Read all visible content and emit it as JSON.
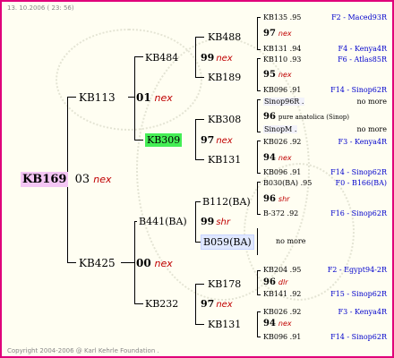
{
  "header": {
    "date": "13. 10.2006 ( 23: 56)"
  },
  "footer": {
    "copyright": "Copyright 2004-2006 @ Karl Kehrle Foundation ."
  },
  "root": {
    "id": "KB169",
    "year": "03",
    "mark": "nex"
  },
  "gen2": [
    {
      "id": "KB113",
      "year": "01",
      "mark": "nex"
    },
    {
      "id": "KB425",
      "year": "00",
      "mark": "nex"
    }
  ],
  "gen3": [
    {
      "id": "KB484",
      "year": "99",
      "mark": "nex"
    },
    {
      "id": "KB309",
      "year": "97",
      "mark": "nex"
    },
    {
      "id": "B441(BA)",
      "year": "99",
      "mark": "shr"
    },
    {
      "id": "KB232",
      "year": "97",
      "mark": "nex"
    }
  ],
  "gen4": [
    {
      "id": "KB488",
      "year": "97",
      "mark": "nex"
    },
    {
      "id": "KB189",
      "year": "95",
      "mark": "nex"
    },
    {
      "id": "KB308",
      "year": "96",
      "mark": "pure anatolica (Sinop)"
    },
    {
      "id": "KB131",
      "year": "94",
      "mark": "nex"
    },
    {
      "id": "B112(BA)",
      "year": "96",
      "mark": "shr"
    },
    {
      "id": "B059(BA)",
      "year": "",
      "mark": "no more"
    },
    {
      "id": "KB178",
      "year": "96",
      "mark": "dlr"
    },
    {
      "id": "KB131",
      "year": "94",
      "mark": "nex"
    }
  ],
  "gen5": [
    {
      "id": "KB135 .95",
      "origin": "F2 - Maced93R"
    },
    {
      "id": "KB131 .94",
      "origin": "F4 - Kenya4R"
    },
    {
      "id": "KB110 .93",
      "origin": "F6 - Atlas85R"
    },
    {
      "id": "KB096 .91",
      "origin": "F14 - Sinop62R"
    },
    {
      "id": "Sinop96R .",
      "origin": "no more"
    },
    {
      "id": "SinopM .",
      "origin": "no more"
    },
    {
      "id": "KB026 .92",
      "origin": "F3 - Kenya4R"
    },
    {
      "id": "KB096 .91",
      "origin": "F14 - Sinop62R"
    },
    {
      "id": "B030(BA) .95",
      "origin": "F0 - B166(BA)"
    },
    {
      "id": "B-372 .92",
      "origin": "F16 - Sinop62R"
    },
    {
      "id": "KB204 .95",
      "origin": "F2 - Egypt94-2R"
    },
    {
      "id": "KB141 .92",
      "origin": "F15 - Sinop62R"
    },
    {
      "id": "KB026 .92",
      "origin": "F3 - Kenya4R"
    },
    {
      "id": "KB096 .91",
      "origin": "F14 - Sinop62R"
    }
  ]
}
